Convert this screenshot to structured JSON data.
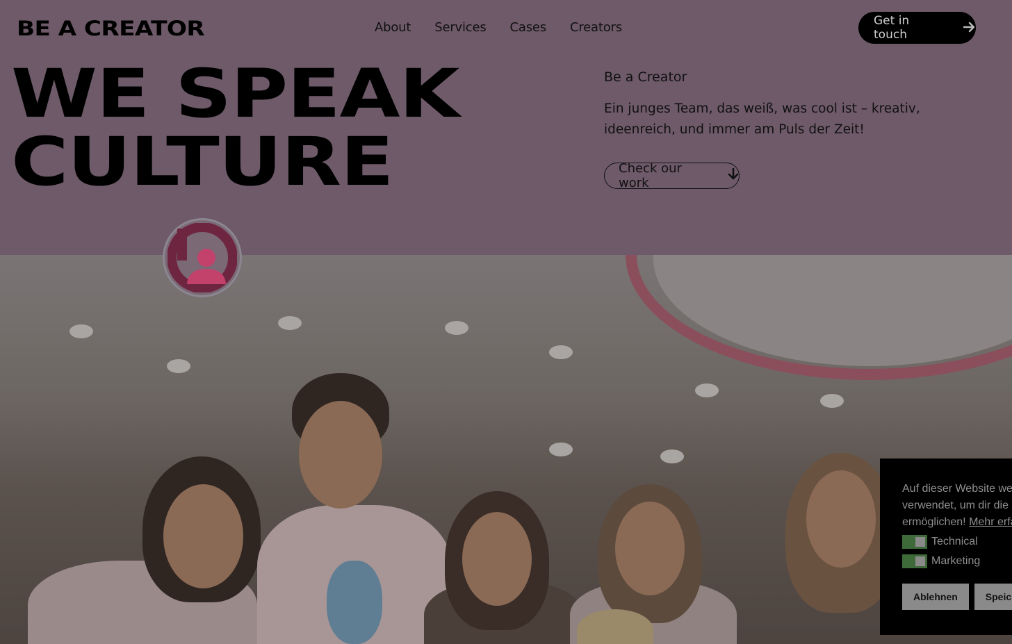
{
  "brand": {
    "logo": "BE A CREATOR"
  },
  "nav": {
    "items": [
      {
        "label": "About"
      },
      {
        "label": "Services"
      },
      {
        "label": "Cases"
      },
      {
        "label": "Creators"
      }
    ]
  },
  "header": {
    "cta_label": "Get in touch",
    "cta_icon": "arrow-right-icon"
  },
  "hero": {
    "title_line1": "WE SPEAK",
    "title_line2": "CULTURE",
    "side_title": "Be a Creator",
    "side_text": "Ein junges Team, das weiß, was cool ist – kreativ, ideenreich, und immer am Puls der Zeit!",
    "work_button_label": "Check our work",
    "work_button_icon": "arrow-down-icon"
  },
  "cookie": {
    "text_line1": "Auf dieser Website we",
    "text_line2": "verwendet, um dir die",
    "text_line3": "ermöglichen!",
    "more_link": "Mehr erfa",
    "toggles": [
      {
        "label": "Technical",
        "checked": true
      },
      {
        "label": "Marketing",
        "checked": true
      }
    ],
    "decline_label": "Ablehnen",
    "save_label": "Speic"
  },
  "colors": {
    "overlay": "#6e5a69",
    "accent": "#c2426c",
    "toggle_on": "#3e6a3a"
  }
}
